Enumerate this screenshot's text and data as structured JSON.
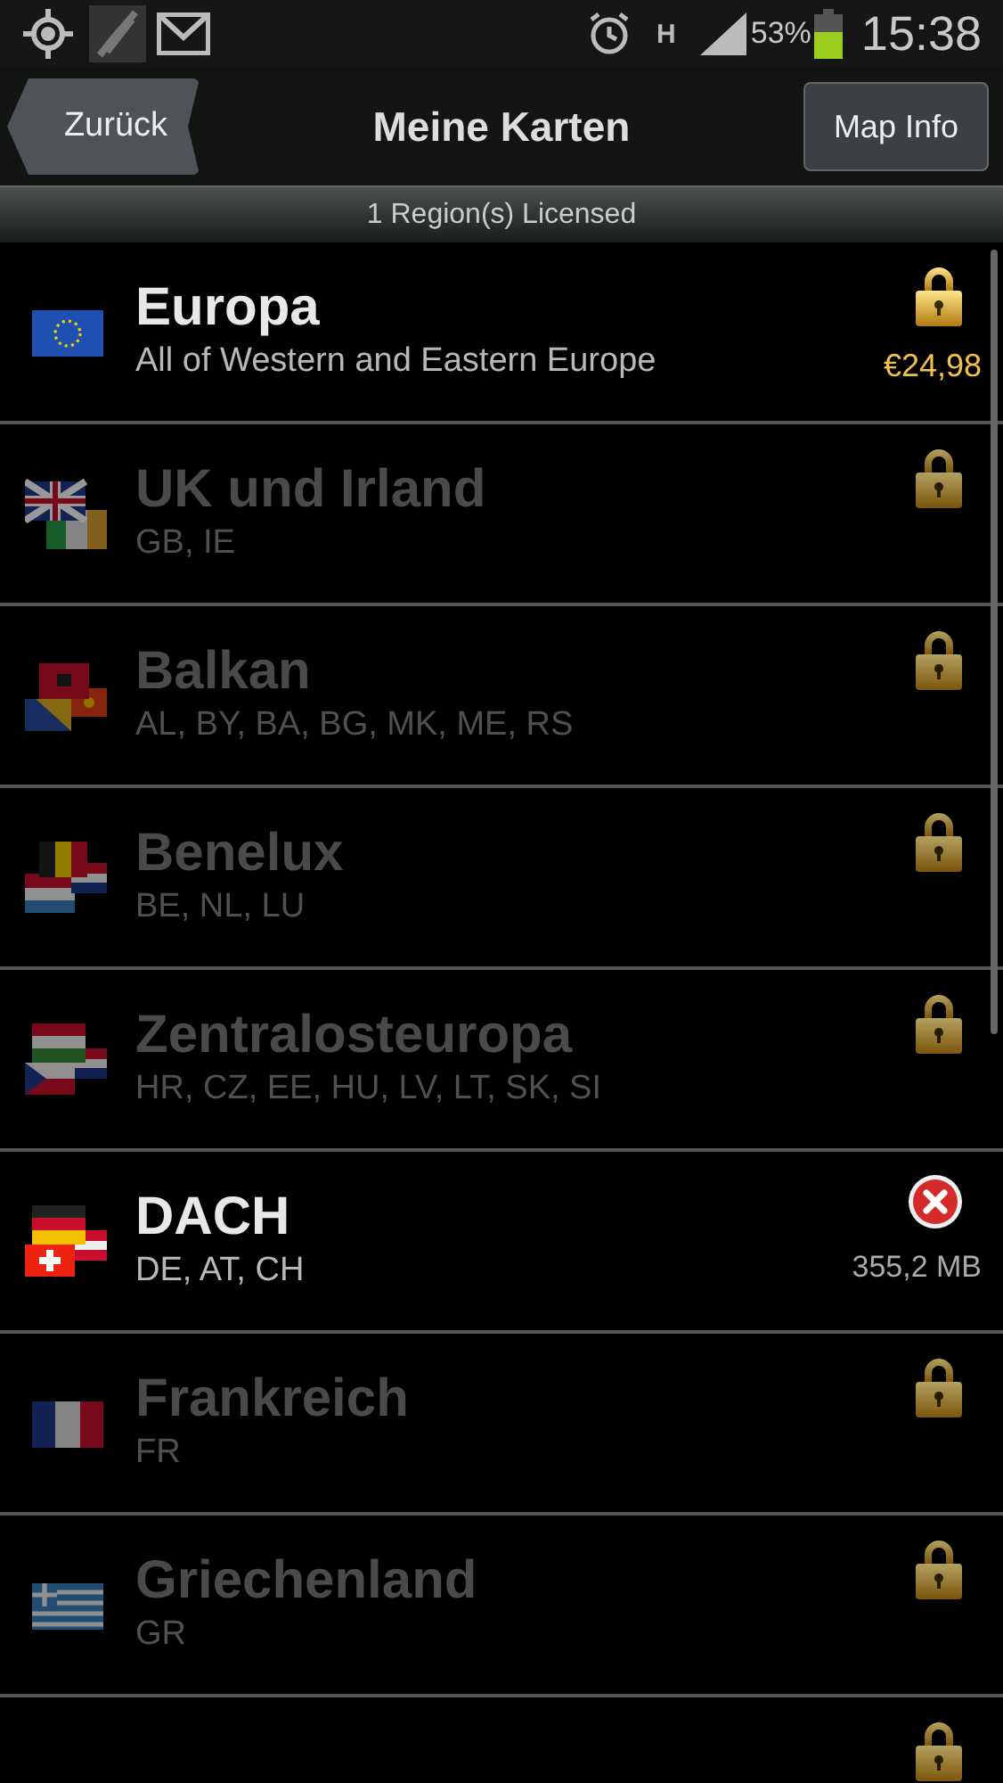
{
  "status_bar": {
    "network_type": "H",
    "battery": "53%",
    "time": "15:38"
  },
  "toolbar": {
    "back": "Zurück",
    "title": "Meine Karten",
    "action": "Map Info"
  },
  "license_banner": "1 Region(s) Licensed",
  "regions": [
    {
      "name": "Europa",
      "codes": "All of Western and Eastern Europe",
      "kind": "locked",
      "enabled": true,
      "price": "€24,98"
    },
    {
      "name": "UK und Irland",
      "codes": "GB, IE",
      "kind": "locked",
      "enabled": false
    },
    {
      "name": "Balkan",
      "codes": "AL, BY, BA, BG, MK, ME, RS",
      "kind": "locked",
      "enabled": false
    },
    {
      "name": "Benelux",
      "codes": "BE, NL, LU",
      "kind": "locked",
      "enabled": false
    },
    {
      "name": "Zentralosteuropa",
      "codes": "HR, CZ, EE, HU, LV, LT, SK, SI",
      "kind": "locked",
      "enabled": false
    },
    {
      "name": "DACH",
      "codes": "DE, AT, CH",
      "kind": "installed",
      "enabled": true,
      "size": "355,2 MB"
    },
    {
      "name": "Frankreich",
      "codes": "FR",
      "kind": "locked",
      "enabled": false
    },
    {
      "name": "Griechenland",
      "codes": "GR",
      "kind": "locked",
      "enabled": false
    },
    {
      "kind": "locked",
      "enabled": false
    }
  ]
}
